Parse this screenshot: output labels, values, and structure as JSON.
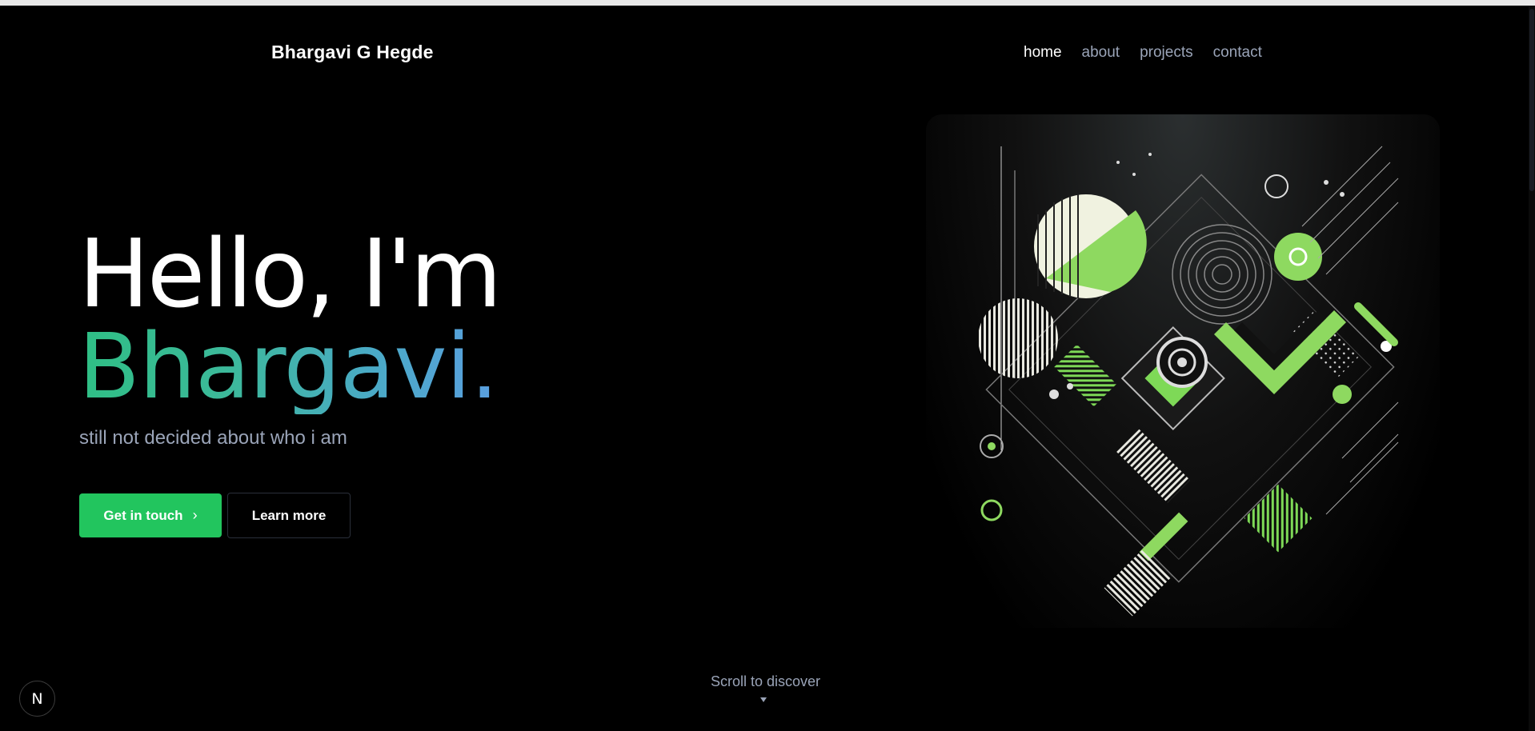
{
  "header": {
    "brand": "Bhargavi G Hegde",
    "nav": [
      {
        "label": "home",
        "active": true
      },
      {
        "label": "about",
        "active": false
      },
      {
        "label": "projects",
        "active": false
      },
      {
        "label": "contact",
        "active": false
      }
    ]
  },
  "hero": {
    "greeting": "Hello, I'm",
    "name": "Bhargavi.",
    "tagline": "still not decided about who i am",
    "primary_button": "Get in touch",
    "primary_button_icon": "chevron-right-icon",
    "secondary_button": "Learn more"
  },
  "scroll_hint": {
    "label": "Scroll to discover",
    "icon": "caret-down-icon"
  },
  "badge": {
    "letter": "N",
    "icon": "nextjs-logo-icon"
  },
  "colors": {
    "background": "#000000",
    "accent": "#22c55e",
    "muted_text": "#9aa4b8",
    "gradient_start": "#2fbf85",
    "gradient_end": "#5a9fe0"
  }
}
